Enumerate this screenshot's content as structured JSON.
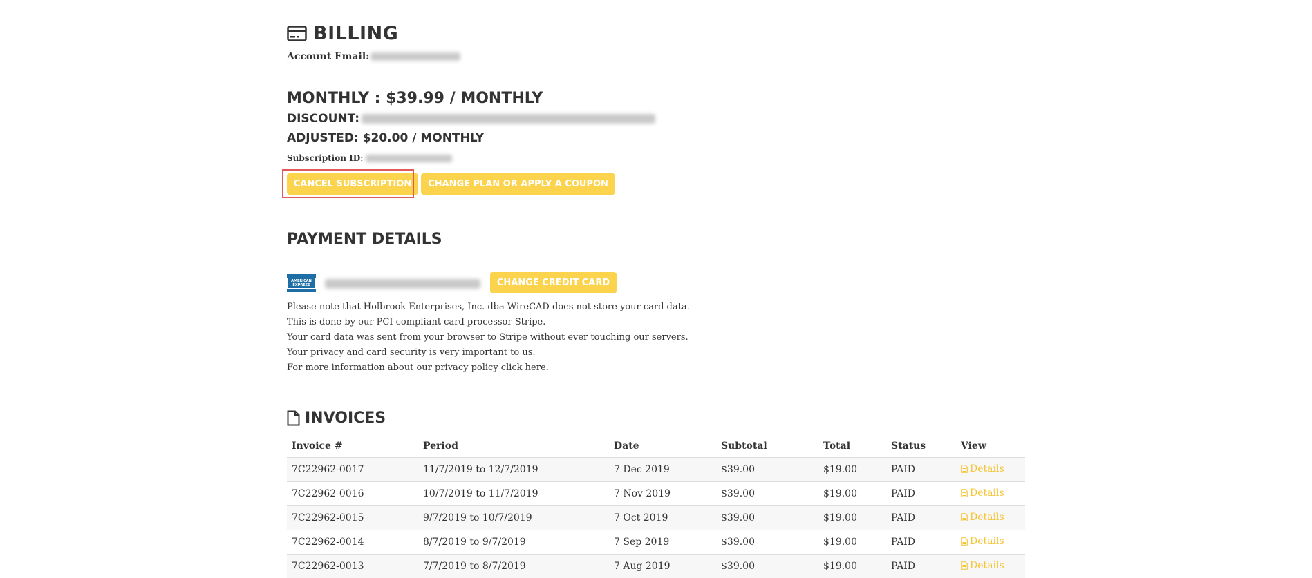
{
  "billing": {
    "title": "BILLING",
    "account_email_label": "Account Email:",
    "monthly": "MONTHLY : $39.99 / MONTHLY",
    "discount_label": "DISCOUNT:",
    "adjusted": "ADJUSTED: $20.00 / MONTHLY",
    "subscription_id_label": "Subscription ID:",
    "cancel_button": "CANCEL SUBSCRIPTION",
    "change_plan_button": "CHANGE PLAN OR APPLY A COUPON"
  },
  "payment": {
    "title": "PAYMENT DETAILS",
    "card_brand": "AMERICAN EXPRESS",
    "change_card_button": "CHANGE CREDIT CARD",
    "notes": [
      "Please note that Holbrook Enterprises, Inc. dba WireCAD does not store your card data.",
      "This is done by our PCI compliant card processor Stripe.",
      "Your card data was sent from your browser to Stripe without ever touching our servers.",
      "Your privacy and card security is very important to us.",
      "For more information about our privacy policy click here."
    ]
  },
  "invoices": {
    "title": "INVOICES",
    "columns": [
      "Invoice #",
      "Period",
      "Date",
      "Subtotal",
      "Total",
      "Status",
      "View"
    ],
    "rows": [
      {
        "invoice": "7C22962-0017",
        "period": "11/7/2019 to 12/7/2019",
        "date": "7 Dec 2019",
        "subtotal": "$39.00",
        "total": "$19.00",
        "status": "PAID",
        "view": "Details"
      },
      {
        "invoice": "7C22962-0016",
        "period": "10/7/2019 to 11/7/2019",
        "date": "7 Nov 2019",
        "subtotal": "$39.00",
        "total": "$19.00",
        "status": "PAID",
        "view": "Details"
      },
      {
        "invoice": "7C22962-0015",
        "period": "9/7/2019 to 10/7/2019",
        "date": "7 Oct 2019",
        "subtotal": "$39.00",
        "total": "$19.00",
        "status": "PAID",
        "view": "Details"
      },
      {
        "invoice": "7C22962-0014",
        "period": "8/7/2019 to 9/7/2019",
        "date": "7 Sep 2019",
        "subtotal": "$39.00",
        "total": "$19.00",
        "status": "PAID",
        "view": "Details"
      },
      {
        "invoice": "7C22962-0013",
        "period": "7/7/2019 to 8/7/2019",
        "date": "7 Aug 2019",
        "subtotal": "$39.00",
        "total": "$19.00",
        "status": "PAID",
        "view": "Details"
      }
    ]
  },
  "colors": {
    "accent": "#fcd34d",
    "link": "#f5c430",
    "highlight_border": "#e05a5a",
    "amex_blue": "#1c6ea4"
  }
}
